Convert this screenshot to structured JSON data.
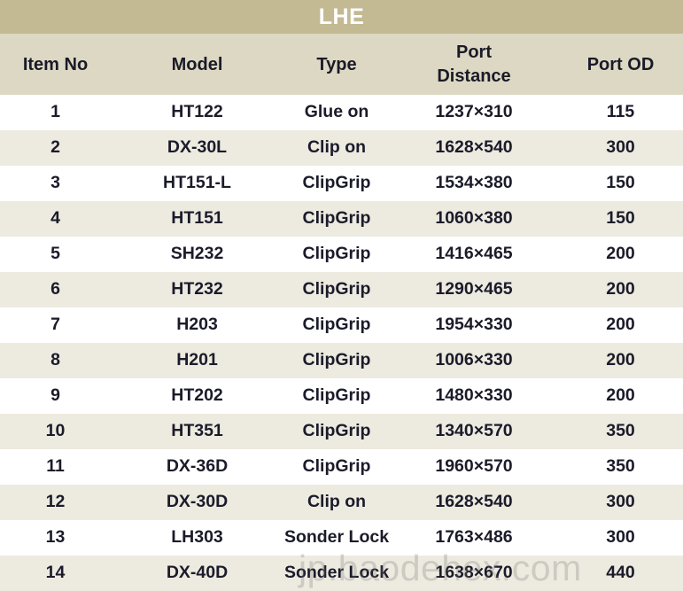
{
  "title_bar": {
    "title": "LHE"
  },
  "table": {
    "columns": [
      {
        "key": "item_no",
        "label": "Item No",
        "wrap": false
      },
      {
        "key": "model",
        "label": "Model",
        "wrap": false
      },
      {
        "key": "type",
        "label": "Type",
        "wrap": false
      },
      {
        "key": "port_distance",
        "label": "Port\nDistance",
        "label_line1": "Port",
        "label_line2": "Distance",
        "wrap": true
      },
      {
        "key": "port_od",
        "label": "Port OD",
        "wrap": false
      }
    ],
    "rows": [
      {
        "item_no": "1",
        "model": "HT122",
        "type": "Glue on",
        "port_distance": "1237×310",
        "port_od": "115"
      },
      {
        "item_no": "2",
        "model": "DX-30L",
        "type": "Clip on",
        "port_distance": "1628×540",
        "port_od": "300"
      },
      {
        "item_no": "3",
        "model": "HT151-L",
        "type": "ClipGrip",
        "port_distance": "1534×380",
        "port_od": "150"
      },
      {
        "item_no": "4",
        "model": "HT151",
        "type": "ClipGrip",
        "port_distance": "1060×380",
        "port_od": "150"
      },
      {
        "item_no": "5",
        "model": "SH232",
        "type": "ClipGrip",
        "port_distance": "1416×465",
        "port_od": "200"
      },
      {
        "item_no": "6",
        "model": "HT232",
        "type": "ClipGrip",
        "port_distance": "1290×465",
        "port_od": "200"
      },
      {
        "item_no": "7",
        "model": "H203",
        "type": "ClipGrip",
        "port_distance": "1954×330",
        "port_od": "200"
      },
      {
        "item_no": "8",
        "model": "H201",
        "type": "ClipGrip",
        "port_distance": "1006×330",
        "port_od": "200"
      },
      {
        "item_no": "9",
        "model": "HT202",
        "type": "ClipGrip",
        "port_distance": "1480×330",
        "port_od": "200"
      },
      {
        "item_no": "10",
        "model": "HT351",
        "type": "ClipGrip",
        "port_distance": "1340×570",
        "port_od": "350"
      },
      {
        "item_no": "11",
        "model": "DX-36D",
        "type": "ClipGrip",
        "port_distance": "1960×570",
        "port_od": "350"
      },
      {
        "item_no": "12",
        "model": "DX-30D",
        "type": "Clip on",
        "port_distance": "1628×540",
        "port_od": "300"
      },
      {
        "item_no": "13",
        "model": "LH303",
        "type": "Sonder Lock",
        "port_distance": "1763×486",
        "port_od": "300"
      },
      {
        "item_no": "14",
        "model": "DX-40D",
        "type": "Sonder Lock",
        "port_distance": "1638×670",
        "port_od": "440"
      }
    ]
  },
  "watermark": {
    "text": "jp.baodehex.com"
  },
  "colors": {
    "title_bar_bg": "#c3b993",
    "title_text": "#ffffff",
    "header_row_bg": "#ddd8c3",
    "row_odd_bg": "#ffffff",
    "row_even_bg": "#edeae0",
    "text": "#1b1b2a",
    "watermark": "#787878"
  }
}
